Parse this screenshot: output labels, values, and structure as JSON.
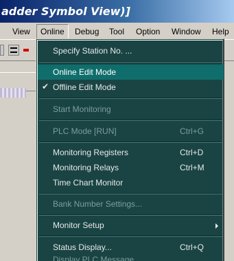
{
  "window": {
    "title": "adder Symbol View)]"
  },
  "menubar": {
    "items": [
      "View",
      "Online",
      "Debug",
      "Tool",
      "Option",
      "Window",
      "Help"
    ]
  },
  "dropdown": {
    "items": [
      {
        "label": "Specify Station No. ...",
        "shortcut": "",
        "enabled": true
      },
      {
        "label": "Online Edit Mode",
        "shortcut": "",
        "enabled": true,
        "highlighted": true
      },
      {
        "label": "Offline Edit Mode",
        "shortcut": "",
        "enabled": true,
        "checked": true,
        "check_glyph": "✔"
      },
      {
        "label": "Start Monitoring",
        "shortcut": "",
        "enabled": false
      },
      {
        "label": "PLC Mode [RUN]",
        "shortcut": "Ctrl+G",
        "enabled": false
      },
      {
        "label": "Monitoring Registers",
        "shortcut": "Ctrl+D",
        "enabled": true
      },
      {
        "label": "Monitoring Relays",
        "shortcut": "Ctrl+M",
        "enabled": true
      },
      {
        "label": "Time Chart Monitor",
        "shortcut": "",
        "enabled": true
      },
      {
        "label": "Bank Number Settings...",
        "shortcut": "",
        "enabled": false
      },
      {
        "label": "Monitor Setup",
        "shortcut": "",
        "enabled": true,
        "submenu": true
      },
      {
        "label": "Status Display...",
        "shortcut": "Ctrl+Q",
        "enabled": true
      },
      {
        "label": "Display PLC Message",
        "shortcut": "",
        "enabled": false
      }
    ]
  },
  "colors": {
    "menu_bg": "#1a4444",
    "menu_highlight": "#0f6e6c",
    "menu_text": "#e8e8e8",
    "menu_disabled": "#7e9c9c",
    "titlebar_start": "#0a246a",
    "titlebar_end": "#a6caf0"
  }
}
